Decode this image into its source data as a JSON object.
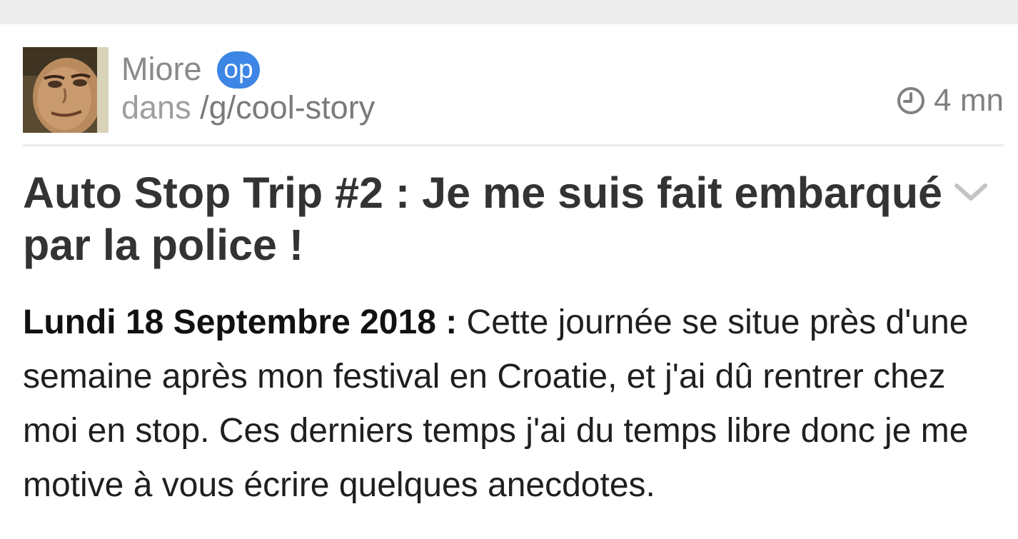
{
  "post": {
    "author": "Miore",
    "op_badge": "op",
    "community_prefix": "dans",
    "community": "/g/cool-story",
    "time_ago": "4 mn",
    "title": "Auto Stop Trip #2 : Je me suis fait embarqué par la police !",
    "body_date": "Lundi 18 Septembre 2018 :",
    "body_text": " Cette journée se situe près d'une semaine après mon festival en Croatie, et j'ai dû rentrer chez moi en stop. Ces derniers temps j'ai du temps libre donc je me motive à vous écrire quelques anecdotes."
  },
  "icons": {
    "clock": "clock-icon",
    "chevron": "chevron-down-icon"
  },
  "colors": {
    "op_badge": "#3d86e6",
    "title": "#333333",
    "meta": "#8a8a8a",
    "top_band": "#ededed"
  }
}
